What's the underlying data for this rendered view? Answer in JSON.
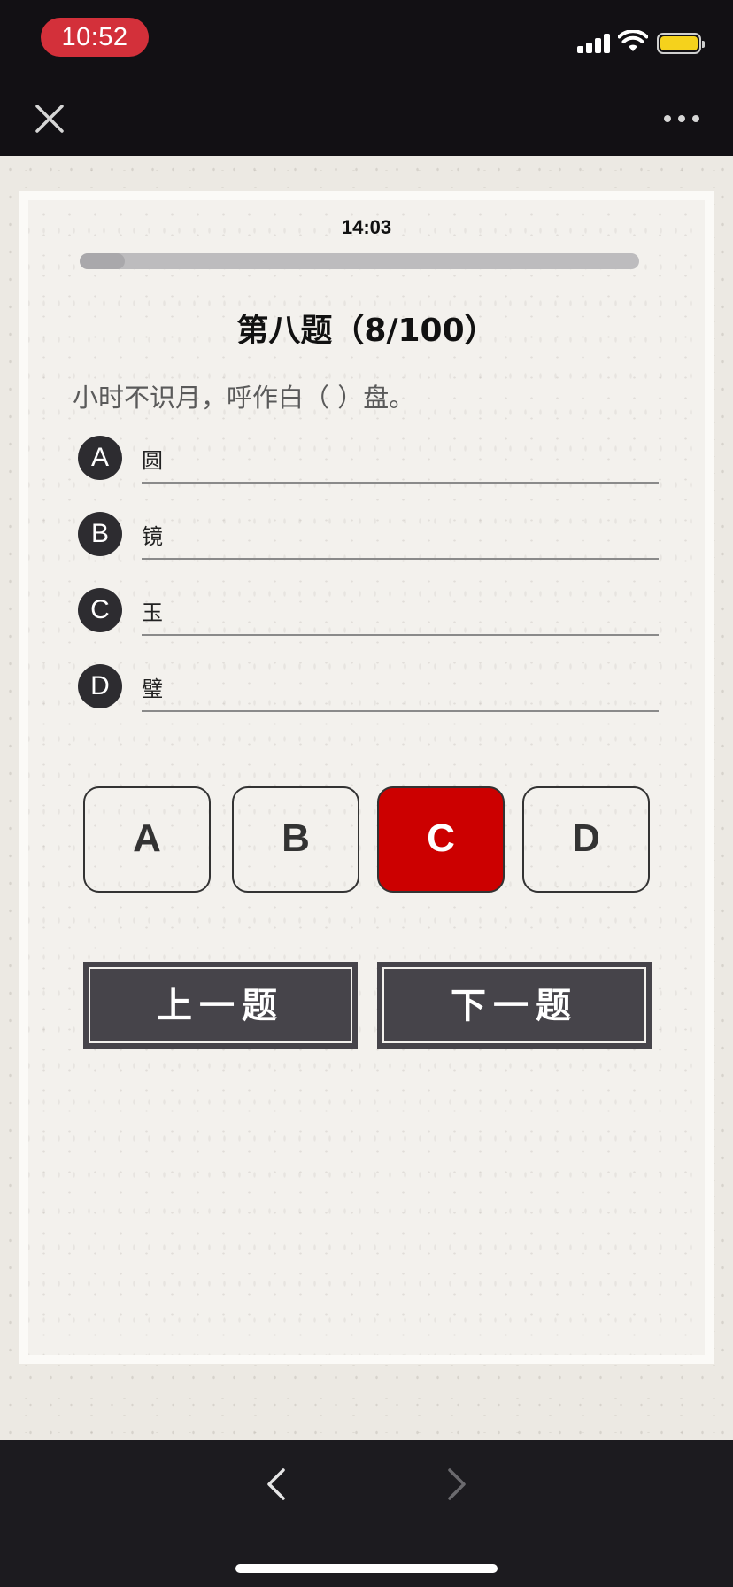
{
  "status_bar": {
    "time": "10:52",
    "signal_icon": "cellular-signal-icon",
    "wifi_icon": "wifi-icon",
    "battery_icon": "battery-icon",
    "battery_color": "#f5d21c",
    "time_pill_color": "#d3303a"
  },
  "nav_bar": {
    "close_icon": "close-icon",
    "more_icon": "more-icon"
  },
  "quiz": {
    "timer": "14:03",
    "progress": 0.08,
    "title": "第八题（8/100）",
    "question": "小时不识月，呼作白（ ）盘。",
    "options": [
      {
        "letter": "A",
        "text": "圆"
      },
      {
        "letter": "B",
        "text": "镜"
      },
      {
        "letter": "C",
        "text": "玉"
      },
      {
        "letter": "D",
        "text": "璧"
      }
    ],
    "answers": [
      "A",
      "B",
      "C",
      "D"
    ],
    "selected_answer": "C",
    "selected_color": "#cc0000",
    "prev_label": "上一题",
    "next_label": "下一题"
  },
  "bottom_bar": {
    "back_icon": "chevron-left-icon",
    "forward_icon": "chevron-right-icon"
  }
}
